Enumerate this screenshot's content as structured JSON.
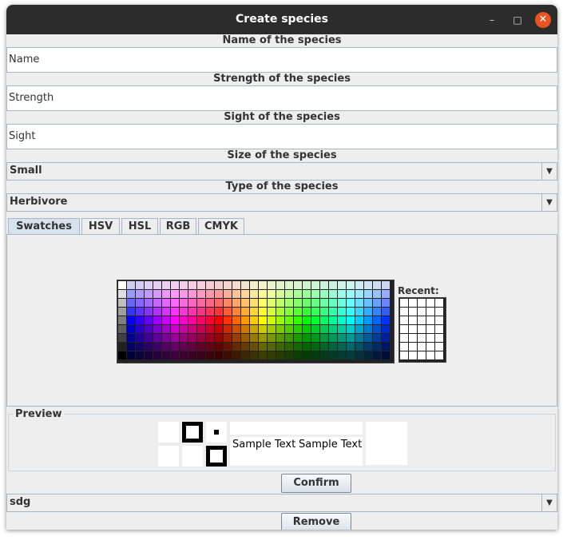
{
  "window": {
    "title": "Create species"
  },
  "fields": {
    "name": {
      "label": "Name of the species",
      "value": "Name"
    },
    "strength": {
      "label": "Strength of the species",
      "value": "Strength"
    },
    "sight": {
      "label": "Sight of the species",
      "value": "Sight"
    },
    "size": {
      "label": "Size of the species",
      "selected": "Small"
    },
    "type": {
      "label": "Type of the species",
      "selected": "Herbivore"
    }
  },
  "color_chooser": {
    "tabs": [
      "Swatches",
      "HSV",
      "HSL",
      "RGB",
      "CMYK"
    ],
    "active_tab": "Swatches",
    "recent_label": "Recent:",
    "preview_label": "Preview",
    "sample_text": "Sample Text"
  },
  "actions": {
    "confirm_label": "Confirm",
    "species_selected": "sdg",
    "remove_label": "Remove"
  },
  "colors": {
    "titlebar": "#2c2c2c",
    "close_button": "#e95420",
    "border": "#a5b6c8"
  }
}
